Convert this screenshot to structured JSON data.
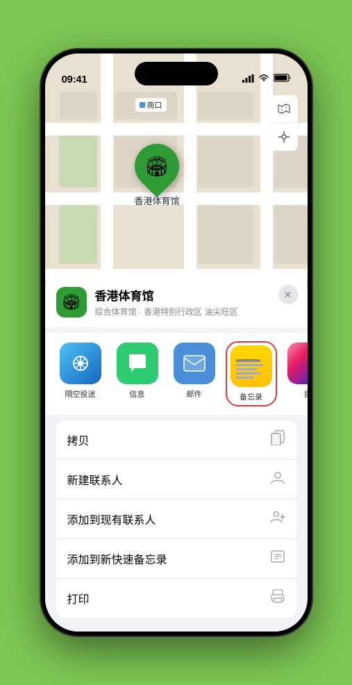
{
  "status_bar": {
    "time": "09:41",
    "signal_icon": "▌▌▌▌",
    "wifi_icon": "WiFi",
    "battery_icon": "Battery",
    "location_icon": "➤"
  },
  "map": {
    "label_text": "南口",
    "pin_emoji": "🏟",
    "pin_label": "香港体育馆",
    "map_type_icon": "🗺",
    "location_icon": "➤"
  },
  "venue": {
    "icon_emoji": "🏟",
    "name": "香港体育馆",
    "subtitle": "综合体育馆 · 香港特别行政区 油尖旺区",
    "close_label": "✕"
  },
  "share_items": [
    {
      "id": "airdrop",
      "label": "隔空投送",
      "type": "airdrop"
    },
    {
      "id": "messages",
      "label": "信息",
      "type": "messages"
    },
    {
      "id": "mail",
      "label": "邮件",
      "type": "mail"
    },
    {
      "id": "notes",
      "label": "备忘录",
      "type": "notes"
    },
    {
      "id": "more",
      "label": "提",
      "type": "more"
    }
  ],
  "actions": [
    {
      "id": "copy",
      "label": "拷贝",
      "icon": "📋"
    },
    {
      "id": "new-contact",
      "label": "新建联系人",
      "icon": "👤"
    },
    {
      "id": "add-existing",
      "label": "添加到现有联系人",
      "icon": "👤"
    },
    {
      "id": "add-notes",
      "label": "添加到新快速备忘录",
      "icon": "📝"
    },
    {
      "id": "print",
      "label": "打印",
      "icon": "🖨"
    }
  ]
}
